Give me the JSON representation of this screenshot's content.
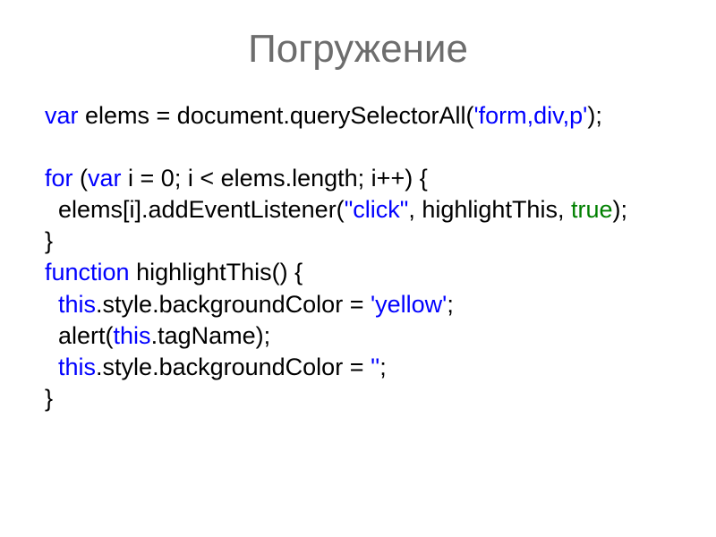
{
  "title": "Погружение",
  "code": {
    "line1_kw": "var",
    "line1_rest": " elems = document.querySelectorAll(",
    "line1_str": "'form,div,p'",
    "line1_end": ");",
    "blank1": " ",
    "line3_kw": "for",
    "line3_rest1": " (",
    "line3_kw2": "var",
    "line3_rest2": " i = 0; i < elems.length; i++) {",
    "line4_indent": "  elems[i].addEventListener(",
    "line4_str": "\"click\"",
    "line4_rest": ", highlightThis, ",
    "line4_true": "true",
    "line4_end": ");",
    "line5": "}",
    "line6_kw": "function",
    "line6_rest": " highlightThis() {",
    "line7_indent": "  ",
    "line7_kw": "this",
    "line7_rest": ".style.backgroundColor = ",
    "line7_str": "'yellow'",
    "line7_end": ";",
    "line8_indent": "  alert(",
    "line8_kw": "this",
    "line8_rest": ".tagName);",
    "line9_indent": "  ",
    "line9_kw": "this",
    "line9_rest": ".style.backgroundColor = ",
    "line9_str": "''",
    "line9_end": ";",
    "line10": "}"
  }
}
